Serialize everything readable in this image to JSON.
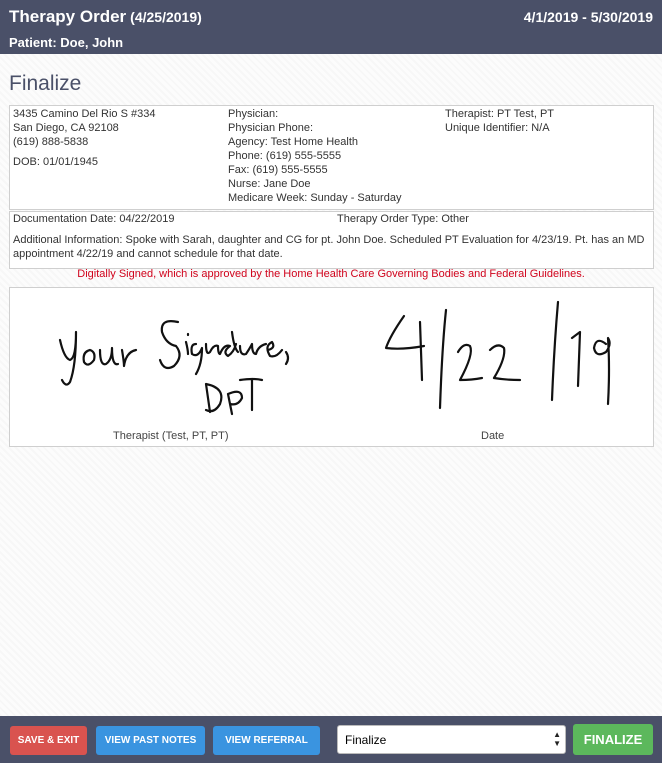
{
  "header": {
    "title": "Therapy Order",
    "title_date": "(4/25/2019)",
    "date_range": "4/1/2019 - 5/30/2019",
    "patient": "Patient: Doe, John"
  },
  "page_title": "Finalize",
  "info": {
    "col1": [
      "3435 Camino Del Rio S #334",
      "San Diego, CA 92108",
      "(619) 888-5838"
    ],
    "dob": "DOB: 01/01/1945",
    "col2": [
      "Physician:",
      "Physician Phone:",
      "Agency: Test Home Health",
      "Phone: (619) 555-5555",
      "Fax: (619) 555-5555",
      "Nurse: Jane Doe",
      "Medicare Week: Sunday - Saturday"
    ],
    "col3": [
      "Therapist: PT Test, PT",
      "Unique Identifier: N/A"
    ]
  },
  "documentation": {
    "date": "Documentation Date: 04/22/2019",
    "order_type": "Therapy Order Type: Other",
    "additional": "Additional Information: Spoke with Sarah, daughter and CG for pt. John Doe. Scheduled PT Evaluation for 4/23/19. Pt. has an MD appointment 4/22/19 and cannot schedule for that date."
  },
  "signed_notice": "Digitally Signed, which is approved by the Home Health Care Governing Bodies and Federal Guidelines.",
  "signature": {
    "handwriting": "your signature, DPT",
    "date_handwriting": "4/22/19",
    "therapist_label": "Therapist (Test, PT, PT)",
    "date_label": "Date"
  },
  "footer": {
    "save_exit": "SAVE & EXIT",
    "view_past_notes": "VIEW PAST NOTES",
    "view_referral": "VIEW REFERRAL",
    "select_value": "Finalize",
    "finalize": "FINALIZE"
  },
  "colors": {
    "header_bg": "#4a5068",
    "danger": "#d9534f",
    "primary": "#3a94e0",
    "success": "#5cb85c",
    "notice": "#d0021b"
  }
}
